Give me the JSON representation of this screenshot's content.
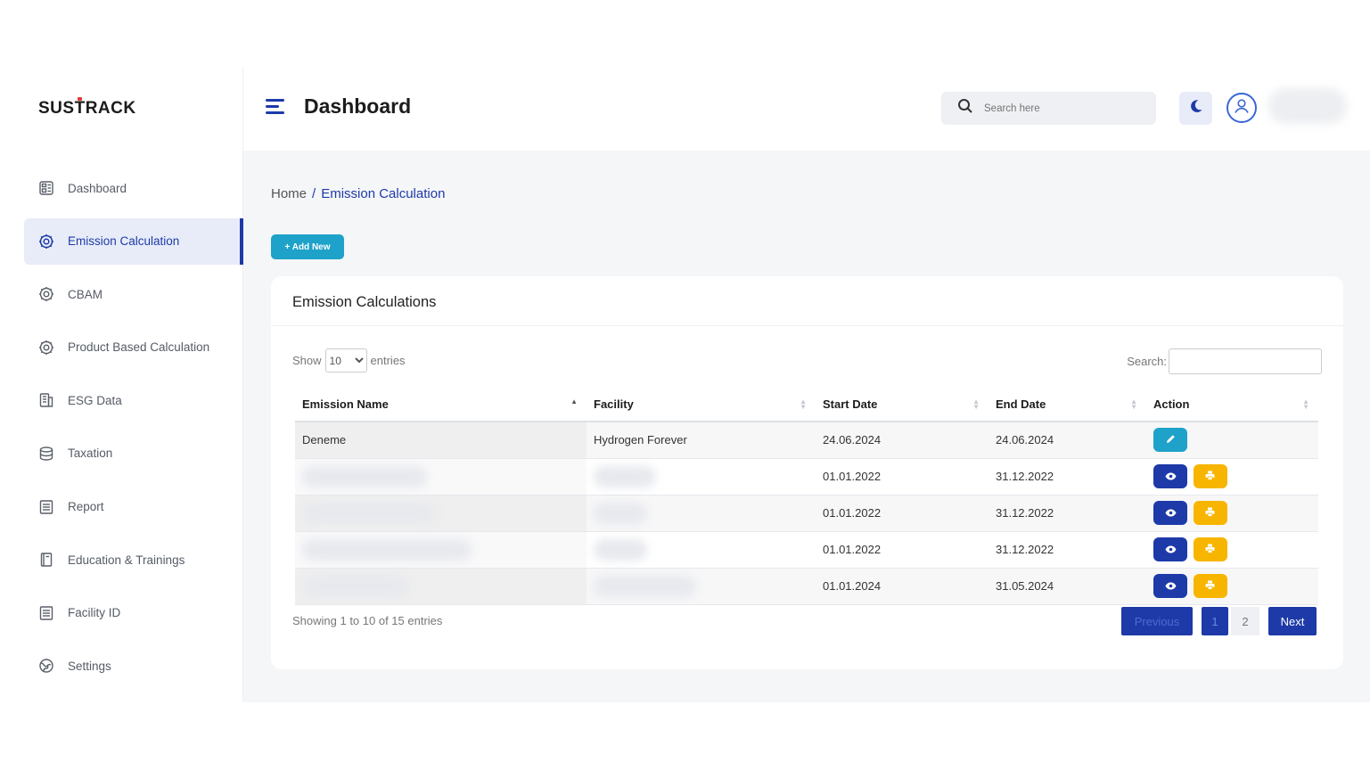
{
  "brand": {
    "logo_text": "SUSTRACK"
  },
  "header": {
    "title": "Dashboard",
    "search_placeholder": "Search here"
  },
  "sidebar": {
    "items": [
      {
        "label": "Dashboard",
        "icon": "dashboard-icon"
      },
      {
        "label": "Emission Calculation",
        "icon": "gear-icon",
        "active": true
      },
      {
        "label": "CBAM",
        "icon": "gear-icon"
      },
      {
        "label": "Product Based Calculation",
        "icon": "gear-icon"
      },
      {
        "label": "ESG Data",
        "icon": "building-icon"
      },
      {
        "label": "Taxation",
        "icon": "database-icon"
      },
      {
        "label": "Report",
        "icon": "list-icon"
      },
      {
        "label": "Education & Trainings",
        "icon": "book-icon"
      },
      {
        "label": "Facility ID",
        "icon": "list-icon"
      },
      {
        "label": "Settings",
        "icon": "globe-icon"
      }
    ]
  },
  "breadcrumb": {
    "home": "Home",
    "separator": "/",
    "current": "Emission Calculation"
  },
  "actions": {
    "add_new": "+ Add New"
  },
  "card": {
    "title": "Emission Calculations",
    "show_label": "Show",
    "entries_label": "entries",
    "page_length": "10",
    "search_label": "Search:"
  },
  "table": {
    "columns": [
      "Emission Name",
      "Facility",
      "Start Date",
      "End Date",
      "Action"
    ],
    "rows": [
      {
        "name": "Deneme",
        "facility": "Hydrogen Forever",
        "start": "24.06.2024",
        "end": "24.06.2024",
        "actions": [
          "edit"
        ]
      },
      {
        "name": "",
        "facility": "",
        "start": "01.01.2022",
        "end": "31.12.2022",
        "actions": [
          "view",
          "print"
        ]
      },
      {
        "name": "",
        "facility": "",
        "start": "01.01.2022",
        "end": "31.12.2022",
        "actions": [
          "view",
          "print"
        ]
      },
      {
        "name": "",
        "facility": "",
        "start": "01.01.2022",
        "end": "31.12.2022",
        "actions": [
          "view",
          "print"
        ]
      },
      {
        "name": "",
        "facility": "",
        "start": "01.01.2024",
        "end": "31.05.2024",
        "actions": [
          "view",
          "print"
        ]
      }
    ]
  },
  "footer": {
    "info": "Showing 1 to 10 of 15 entries",
    "previous": "Previous",
    "page1": "1",
    "page2": "2",
    "next": "Next"
  },
  "colors": {
    "primary": "#1d3aa8",
    "accent": "#1ea2c9",
    "warning": "#f7b500",
    "background": "#f5f6f8"
  }
}
